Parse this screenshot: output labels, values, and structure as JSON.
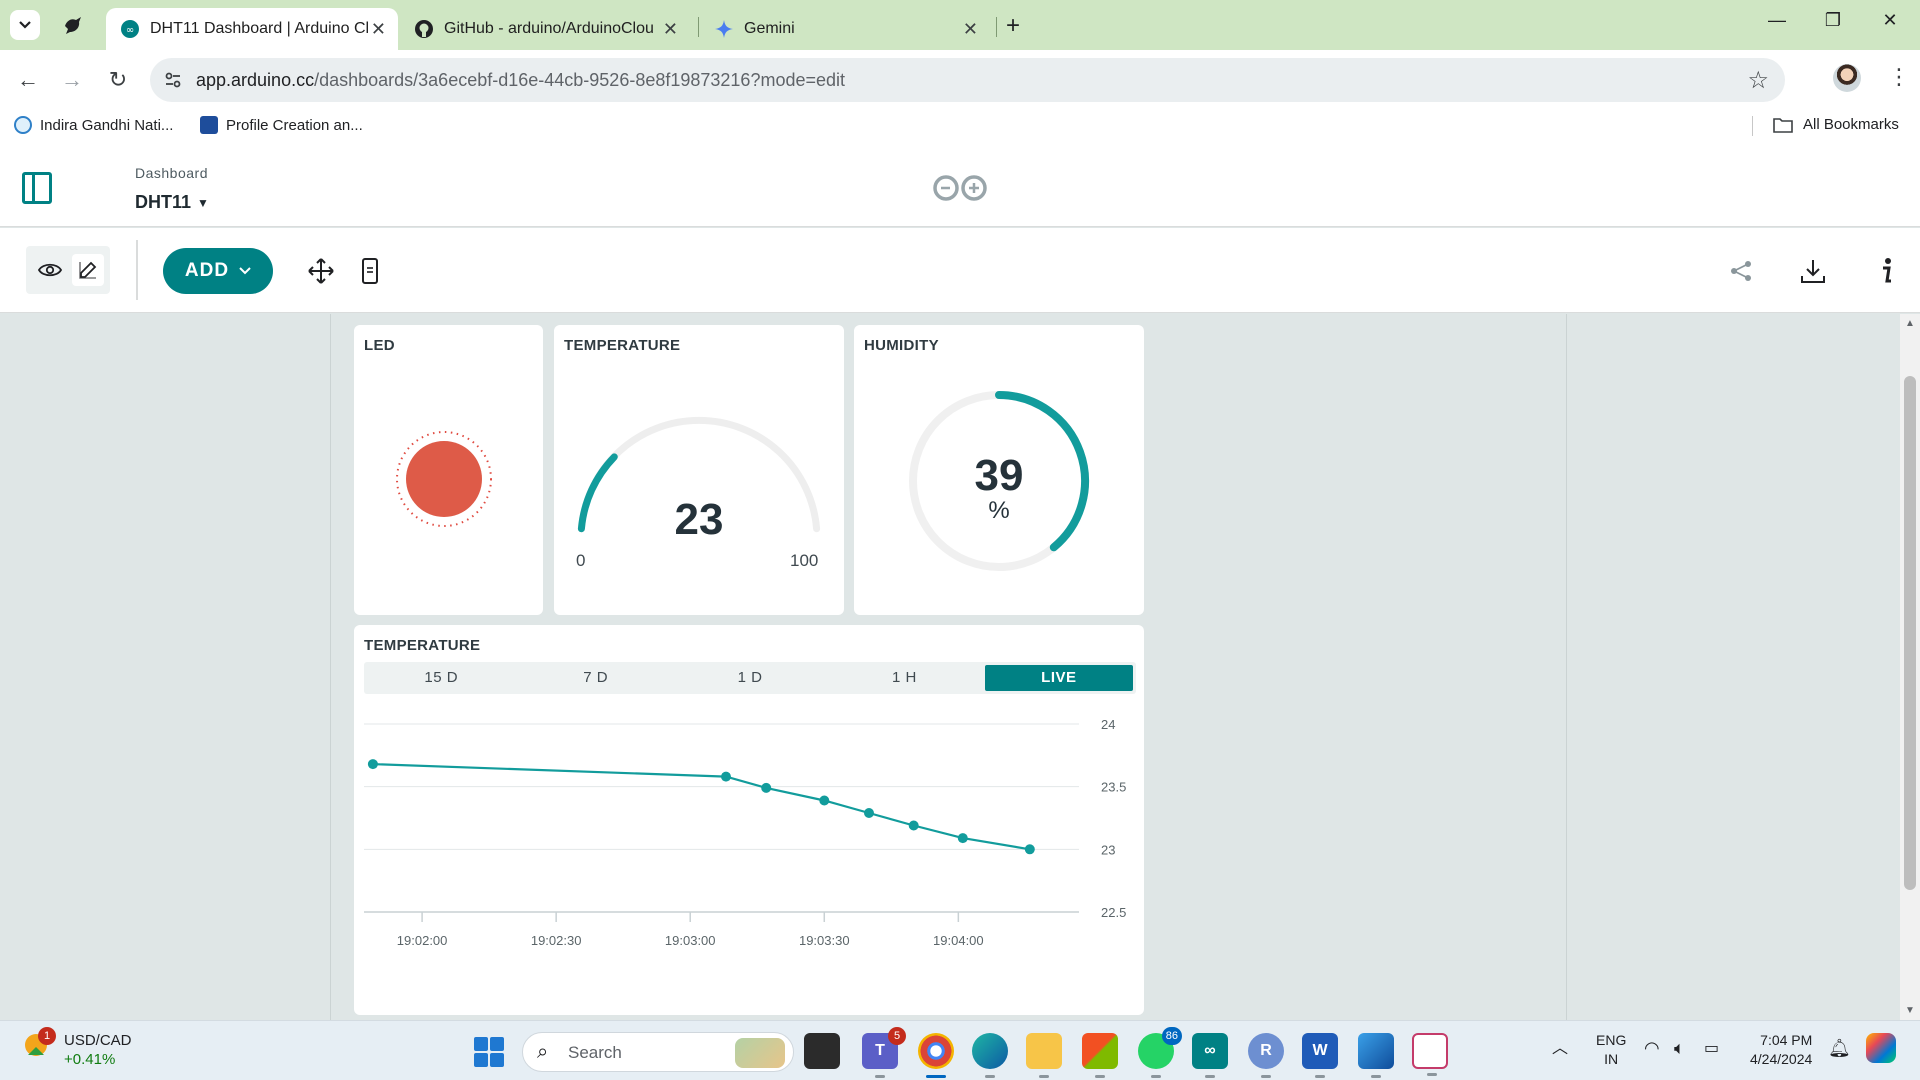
{
  "browser": {
    "tabs": [
      {
        "title": "DHT11 Dashboard | Arduino Cl",
        "active": true
      },
      {
        "title": "GitHub - arduino/ArduinoClou",
        "active": false
      },
      {
        "title": "Gemini",
        "active": false
      }
    ],
    "new_tab_label": "+",
    "url_host": "app.arduino.cc",
    "url_path": "/dashboards/3a6ecebf-d16e-44cb-9526-8e8f19873216?mode=edit",
    "bookmarks": [
      {
        "label": "Indira Gandhi Nati..."
      },
      {
        "label": "Profile Creation an..."
      }
    ],
    "all_bookmarks_label": "All Bookmarks"
  },
  "header": {
    "breadcrumb_label": "Dashboard",
    "dashboard_name": "DHT11",
    "brand_color": "#008184"
  },
  "toolbar": {
    "add_label": "ADD"
  },
  "widgets": {
    "led": {
      "title": "LED",
      "state": "on",
      "color": "#de5b48"
    },
    "temperature_gauge": {
      "title": "TEMPERATURE",
      "value": "23",
      "min": "0",
      "max": "100",
      "fraction": 0.23
    },
    "humidity": {
      "title": "HUMIDITY",
      "value": "39",
      "unit": "%",
      "fraction": 0.39
    },
    "temperature_chart": {
      "title": "TEMPERATURE",
      "ranges": [
        "15 D",
        "7 D",
        "1 D",
        "1 H",
        "LIVE"
      ],
      "active_range": "LIVE"
    }
  },
  "chart_data": {
    "type": "line",
    "title": "TEMPERATURE",
    "xlabel": "",
    "ylabel": "",
    "x_ticks": [
      "19:02:00",
      "19:02:30",
      "19:03:00",
      "19:03:30",
      "19:04:00"
    ],
    "y_ticks": [
      "24",
      "23.5",
      "23",
      "22.5"
    ],
    "xlim": [
      "19:01:47",
      "19:04:27"
    ],
    "ylim": [
      22.5,
      24
    ],
    "grid": true,
    "series": [
      {
        "x": [
          "19:01:49",
          "19:03:08",
          "19:03:17",
          "19:03:30",
          "19:03:40",
          "19:03:50",
          "19:04:01",
          "19:04:16"
        ],
        "y": [
          23.68,
          23.58,
          23.49,
          23.39,
          23.29,
          23.19,
          23.09,
          23.0
        ],
        "color": "#129c9c"
      }
    ]
  },
  "taskbar": {
    "ticker_pair": "USD/CAD",
    "ticker_change": "+0.41%",
    "ticker_badge": "1",
    "search_placeholder": "Search",
    "teams_badge": "5",
    "whatsapp_badge": "86",
    "language": "ENG",
    "region": "IN",
    "time": "7:04 PM",
    "date": "4/24/2024"
  }
}
